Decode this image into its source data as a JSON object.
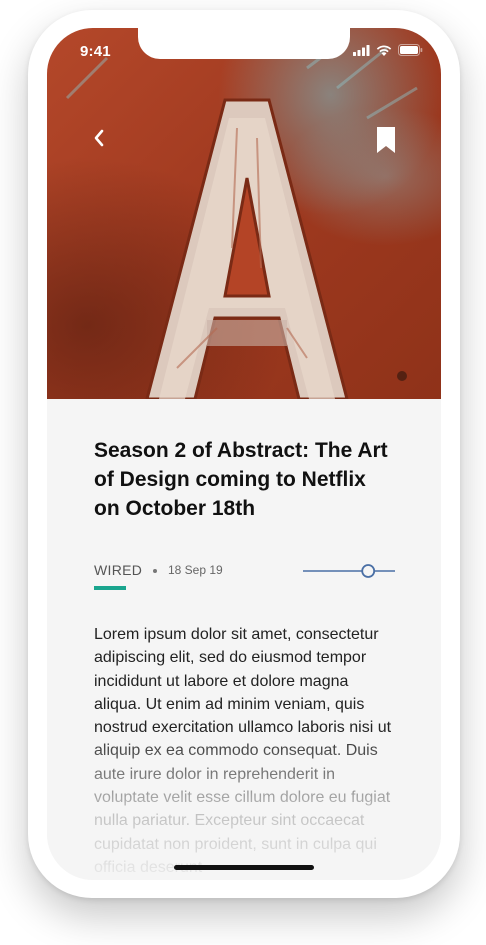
{
  "status_bar": {
    "time": "9:41"
  },
  "article": {
    "title": "Season 2 of Abstract: The Art of Design coming to Netflix on October 18th",
    "source": "WIRED",
    "date": "18 Sep 19",
    "body": "Lorem ipsum dolor sit amet, consectetur adipiscing elit, sed do eiusmod tempor incididunt ut labore et dolore magna aliqua. Ut enim ad minim veniam, quis nostrud exercitation ullamco laboris nisi ut aliquip ex ea commodo consequat. Duis aute irure dolor in reprehenderit in voluptate velit esse cillum dolore eu fugiat nulla pariatur. Excepteur sint occaecat cupidatat non proident, sunt in culpa qui officia deserunt"
  },
  "hero": {
    "letter": "A"
  },
  "text_size_slider": {
    "value_fraction": 0.74
  },
  "icons": {
    "back": "chevron-left-icon",
    "bookmark": "bookmark-icon",
    "signal": "cellular-signal-icon",
    "wifi": "wifi-icon",
    "battery": "battery-icon"
  },
  "colors": {
    "accent": "#1aa58e",
    "slider": "#4a6fa5",
    "hero_red": "#a13a20"
  }
}
